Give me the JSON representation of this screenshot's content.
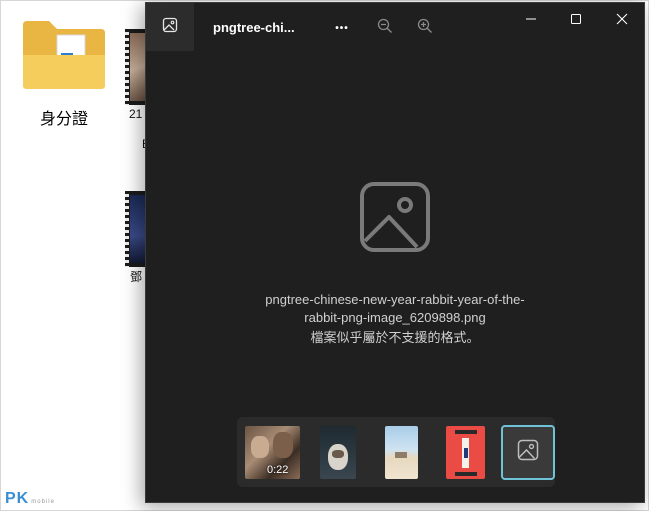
{
  "desktop": {
    "folder_label": "身分證",
    "video1_label_partial": "21",
    "video1_label_line2_partial": "B",
    "video2_label_partial": "鄧"
  },
  "viewer": {
    "title": "pngtree-chi...",
    "more_label": "•••",
    "filename_line1": "pngtree-chinese-new-year-rabbit-year-of-the-",
    "filename_line2": "rabbit-png-image_6209898.png",
    "unsupported_message": "檔案似乎屬於不支援的格式。",
    "filmstrip": {
      "thumbnails": [
        {
          "name": "video-thumbnail",
          "duration": "0:22"
        },
        {
          "name": "cat-thumbnail"
        },
        {
          "name": "beach-thumbnail"
        },
        {
          "name": "red-poster-thumbnail"
        },
        {
          "name": "unsupported-image-thumbnail",
          "selected": true
        }
      ]
    }
  },
  "watermark": {
    "brand": "PK",
    "sub": "mobile"
  },
  "colors": {
    "viewer_bg": "#1f1f1f",
    "accent_selection": "#6fc3d7",
    "text_primary": "#ffffff",
    "text_secondary": "#d0d0d0"
  }
}
